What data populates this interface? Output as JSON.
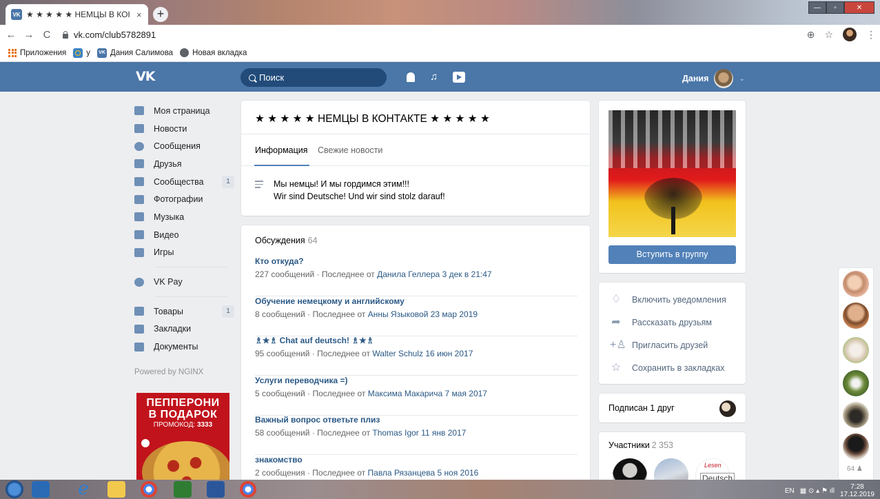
{
  "browser": {
    "tab_title": "★ ★ ★ ★ ★ НЕМЦЫ В КОНТАКТ",
    "tab_close": "×",
    "new_tab": "+",
    "url": "vk.com/club5782891",
    "nav_back": "←",
    "nav_forward": "→",
    "nav_reload": "C",
    "zoom_icon": "⊕",
    "star_icon": "☆",
    "menu_icon": "⋮",
    "bookmarks": [
      {
        "label": "Приложения",
        "icon": "apps-icon"
      },
      {
        "label": "у",
        "icon": "camera-icon"
      },
      {
        "label": "Дания Салимова",
        "icon": "vk-icon"
      },
      {
        "label": "Новая вкладка",
        "icon": "globe-icon"
      }
    ]
  },
  "vk_header": {
    "logo": "VK",
    "search_placeholder": "Поиск",
    "user_name": "Дания",
    "chevron": "⌄"
  },
  "left_menu": {
    "items": [
      {
        "label": "Моя страница",
        "icon": "home-icon",
        "count": ""
      },
      {
        "label": "Новости",
        "icon": "news-icon",
        "count": ""
      },
      {
        "label": "Сообщения",
        "icon": "messages-icon",
        "count": ""
      },
      {
        "label": "Друзья",
        "icon": "friends-icon",
        "count": ""
      },
      {
        "label": "Сообщества",
        "icon": "communities-icon",
        "count": "1"
      },
      {
        "label": "Фотографии",
        "icon": "camera-icon",
        "count": ""
      },
      {
        "label": "Музыка",
        "icon": "music-icon",
        "count": ""
      },
      {
        "label": "Видео",
        "icon": "video-icon",
        "count": ""
      },
      {
        "label": "Игры",
        "icon": "games-icon",
        "count": ""
      }
    ],
    "vkpay": "VK Pay",
    "items2": [
      {
        "label": "Товары",
        "icon": "bag-icon",
        "count": "1"
      },
      {
        "label": "Закладки",
        "icon": "star-icon",
        "count": ""
      },
      {
        "label": "Документы",
        "icon": "document-icon",
        "count": ""
      }
    ],
    "powered": "Powered by NGINX",
    "ad": {
      "line1": "ПЕППЕРОНИ",
      "line2": "В ПОДАРОК",
      "promo_label": "ПРОМОКОД:",
      "promo_code": "3333"
    }
  },
  "group": {
    "title": "★ ★ ★ ★ ★ НЕМЦЫ В КОНТАКТЕ ★ ★ ★ ★ ★",
    "tabs": [
      "Информация",
      "Свежие новости"
    ],
    "description_1": "Мы немцы! И мы гордимся этим!!!",
    "description_2": "Wir sind Deutsche! Und wir sind stolz darauf!"
  },
  "discussions": {
    "title": "Обсуждения",
    "count": "64",
    "topics": [
      {
        "title": "Кто откуда?",
        "meta": "227 сообщений · Последнее от ",
        "who": "Данила Геллера 3 дек в 21:47"
      },
      {
        "title": "Обучение немецкому и английскому",
        "meta": "8 сообщений · Последнее от ",
        "who": "Анны Языковой 23 мар 2019"
      },
      {
        "title": "♗★♗ Chat auf deutsch! ♗★♗",
        "meta": "95 сообщений · Последнее от ",
        "who": "Walter Schulz 16 июн 2017"
      },
      {
        "title": "Услуги переводчика =)",
        "meta": "5 сообщений · Последнее от ",
        "who": "Максима Макарича 7 мая 2017"
      },
      {
        "title": "Важный вопрос ответьте плиз",
        "meta": "58 сообщений · Последнее от ",
        "who": "Thomas Igor 11 янв 2017"
      },
      {
        "title": "знакомство",
        "meta": "2 сообщения · Последнее от ",
        "who": "Павла Рязанцева 5 ноя 2016"
      }
    ]
  },
  "right": {
    "join_button": "Вступить в группу",
    "actions": [
      {
        "label": "Включить уведомления",
        "icon": "bell-icon",
        "glyph": "🔔"
      },
      {
        "label": "Рассказать друзьям",
        "icon": "share-icon",
        "glyph": "➦"
      },
      {
        "label": "Пригласить друзей",
        "icon": "invite-icon",
        "glyph": "+"
      },
      {
        "label": "Сохранить в закладках",
        "icon": "star-icon",
        "glyph": "☆"
      }
    ],
    "subscribed": "Подписан 1 друг",
    "members_title": "Участники",
    "members_count": "2 353",
    "member3_text1": "Lesen",
    "member3_text2": "Deutsch"
  },
  "online": {
    "count": "64"
  },
  "taskbar": {
    "lang": "EN",
    "time": "7:28",
    "date": "17.12.2019"
  },
  "colors": {
    "vk_blue": "#4a76a8",
    "link": "#2a5885",
    "button": "#5181b8"
  }
}
